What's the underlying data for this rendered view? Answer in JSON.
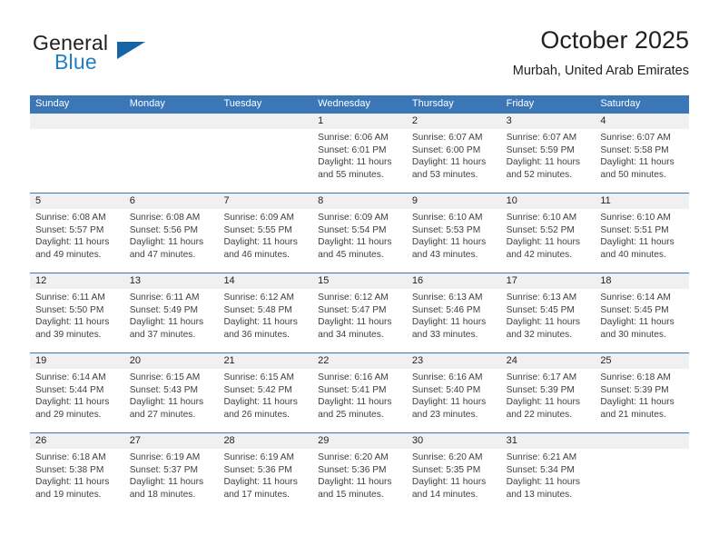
{
  "logo": {
    "word_one": "General",
    "word_two": "Blue",
    "triangle_color": "#1664a8",
    "blue_text_color": "#1f7fc4",
    "icon": "general-blue-logo"
  },
  "header": {
    "title": "October 2025",
    "subtitle": "Murbah, United Arab Emirates"
  },
  "theme": {
    "header_band": "#3b76b7",
    "daynum_band": "#f0f0f0",
    "text": "#231f20",
    "body_text": "#3f3f3f"
  },
  "weekdays": [
    "Sunday",
    "Monday",
    "Tuesday",
    "Wednesday",
    "Thursday",
    "Friday",
    "Saturday"
  ],
  "labels": {
    "sunrise_prefix": "Sunrise:",
    "sunset_prefix": "Sunset:",
    "daylight_prefix": "Daylight:"
  },
  "weeks": [
    {
      "days": [
        {
          "num": "",
          "lines": [
            "",
            "",
            "",
            ""
          ]
        },
        {
          "num": "",
          "lines": [
            "",
            "",
            "",
            ""
          ]
        },
        {
          "num": "",
          "lines": [
            "",
            "",
            "",
            ""
          ]
        },
        {
          "num": "1",
          "lines": [
            "Sunrise: 6:06 AM",
            "Sunset: 6:01 PM",
            "Daylight: 11 hours",
            "and 55 minutes."
          ]
        },
        {
          "num": "2",
          "lines": [
            "Sunrise: 6:07 AM",
            "Sunset: 6:00 PM",
            "Daylight: 11 hours",
            "and 53 minutes."
          ]
        },
        {
          "num": "3",
          "lines": [
            "Sunrise: 6:07 AM",
            "Sunset: 5:59 PM",
            "Daylight: 11 hours",
            "and 52 minutes."
          ]
        },
        {
          "num": "4",
          "lines": [
            "Sunrise: 6:07 AM",
            "Sunset: 5:58 PM",
            "Daylight: 11 hours",
            "and 50 minutes."
          ]
        }
      ]
    },
    {
      "days": [
        {
          "num": "5",
          "lines": [
            "Sunrise: 6:08 AM",
            "Sunset: 5:57 PM",
            "Daylight: 11 hours",
            "and 49 minutes."
          ]
        },
        {
          "num": "6",
          "lines": [
            "Sunrise: 6:08 AM",
            "Sunset: 5:56 PM",
            "Daylight: 11 hours",
            "and 47 minutes."
          ]
        },
        {
          "num": "7",
          "lines": [
            "Sunrise: 6:09 AM",
            "Sunset: 5:55 PM",
            "Daylight: 11 hours",
            "and 46 minutes."
          ]
        },
        {
          "num": "8",
          "lines": [
            "Sunrise: 6:09 AM",
            "Sunset: 5:54 PM",
            "Daylight: 11 hours",
            "and 45 minutes."
          ]
        },
        {
          "num": "9",
          "lines": [
            "Sunrise: 6:10 AM",
            "Sunset: 5:53 PM",
            "Daylight: 11 hours",
            "and 43 minutes."
          ]
        },
        {
          "num": "10",
          "lines": [
            "Sunrise: 6:10 AM",
            "Sunset: 5:52 PM",
            "Daylight: 11 hours",
            "and 42 minutes."
          ]
        },
        {
          "num": "11",
          "lines": [
            "Sunrise: 6:10 AM",
            "Sunset: 5:51 PM",
            "Daylight: 11 hours",
            "and 40 minutes."
          ]
        }
      ]
    },
    {
      "days": [
        {
          "num": "12",
          "lines": [
            "Sunrise: 6:11 AM",
            "Sunset: 5:50 PM",
            "Daylight: 11 hours",
            "and 39 minutes."
          ]
        },
        {
          "num": "13",
          "lines": [
            "Sunrise: 6:11 AM",
            "Sunset: 5:49 PM",
            "Daylight: 11 hours",
            "and 37 minutes."
          ]
        },
        {
          "num": "14",
          "lines": [
            "Sunrise: 6:12 AM",
            "Sunset: 5:48 PM",
            "Daylight: 11 hours",
            "and 36 minutes."
          ]
        },
        {
          "num": "15",
          "lines": [
            "Sunrise: 6:12 AM",
            "Sunset: 5:47 PM",
            "Daylight: 11 hours",
            "and 34 minutes."
          ]
        },
        {
          "num": "16",
          "lines": [
            "Sunrise: 6:13 AM",
            "Sunset: 5:46 PM",
            "Daylight: 11 hours",
            "and 33 minutes."
          ]
        },
        {
          "num": "17",
          "lines": [
            "Sunrise: 6:13 AM",
            "Sunset: 5:45 PM",
            "Daylight: 11 hours",
            "and 32 minutes."
          ]
        },
        {
          "num": "18",
          "lines": [
            "Sunrise: 6:14 AM",
            "Sunset: 5:45 PM",
            "Daylight: 11 hours",
            "and 30 minutes."
          ]
        }
      ]
    },
    {
      "days": [
        {
          "num": "19",
          "lines": [
            "Sunrise: 6:14 AM",
            "Sunset: 5:44 PM",
            "Daylight: 11 hours",
            "and 29 minutes."
          ]
        },
        {
          "num": "20",
          "lines": [
            "Sunrise: 6:15 AM",
            "Sunset: 5:43 PM",
            "Daylight: 11 hours",
            "and 27 minutes."
          ]
        },
        {
          "num": "21",
          "lines": [
            "Sunrise: 6:15 AM",
            "Sunset: 5:42 PM",
            "Daylight: 11 hours",
            "and 26 minutes."
          ]
        },
        {
          "num": "22",
          "lines": [
            "Sunrise: 6:16 AM",
            "Sunset: 5:41 PM",
            "Daylight: 11 hours",
            "and 25 minutes."
          ]
        },
        {
          "num": "23",
          "lines": [
            "Sunrise: 6:16 AM",
            "Sunset: 5:40 PM",
            "Daylight: 11 hours",
            "and 23 minutes."
          ]
        },
        {
          "num": "24",
          "lines": [
            "Sunrise: 6:17 AM",
            "Sunset: 5:39 PM",
            "Daylight: 11 hours",
            "and 22 minutes."
          ]
        },
        {
          "num": "25",
          "lines": [
            "Sunrise: 6:18 AM",
            "Sunset: 5:39 PM",
            "Daylight: 11 hours",
            "and 21 minutes."
          ]
        }
      ]
    },
    {
      "days": [
        {
          "num": "26",
          "lines": [
            "Sunrise: 6:18 AM",
            "Sunset: 5:38 PM",
            "Daylight: 11 hours",
            "and 19 minutes."
          ]
        },
        {
          "num": "27",
          "lines": [
            "Sunrise: 6:19 AM",
            "Sunset: 5:37 PM",
            "Daylight: 11 hours",
            "and 18 minutes."
          ]
        },
        {
          "num": "28",
          "lines": [
            "Sunrise: 6:19 AM",
            "Sunset: 5:36 PM",
            "Daylight: 11 hours",
            "and 17 minutes."
          ]
        },
        {
          "num": "29",
          "lines": [
            "Sunrise: 6:20 AM",
            "Sunset: 5:36 PM",
            "Daylight: 11 hours",
            "and 15 minutes."
          ]
        },
        {
          "num": "30",
          "lines": [
            "Sunrise: 6:20 AM",
            "Sunset: 5:35 PM",
            "Daylight: 11 hours",
            "and 14 minutes."
          ]
        },
        {
          "num": "31",
          "lines": [
            "Sunrise: 6:21 AM",
            "Sunset: 5:34 PM",
            "Daylight: 11 hours",
            "and 13 minutes."
          ]
        },
        {
          "num": "",
          "lines": [
            "",
            "",
            "",
            ""
          ]
        }
      ]
    }
  ]
}
